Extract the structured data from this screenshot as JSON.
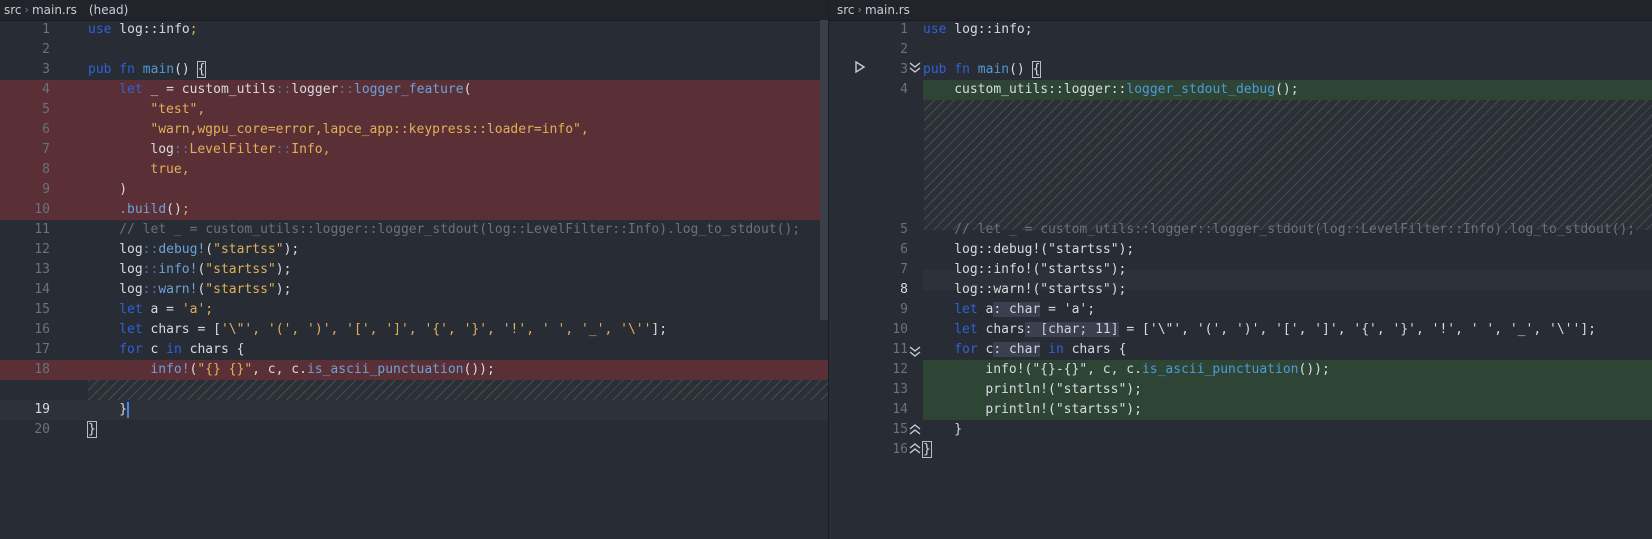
{
  "left": {
    "breadcrumb": [
      "src",
      "main.rs"
    ],
    "tag": "(head)",
    "line_numbers": [
      "1",
      "2",
      "3",
      "4",
      "5",
      "6",
      "7",
      "8",
      "9",
      "10",
      "11",
      "12",
      "13",
      "14",
      "15",
      "16",
      "17",
      "18",
      "19",
      "20"
    ],
    "current_line": "19"
  },
  "right": {
    "breadcrumb": [
      "src",
      "main.rs"
    ],
    "line_numbers": [
      "1",
      "2",
      "3",
      "4",
      "5",
      "6",
      "7",
      "8",
      "9",
      "10",
      "11",
      "12",
      "13",
      "14",
      "15",
      "16"
    ],
    "current_line": "8"
  },
  "icons": {
    "run": "play-icon",
    "fold": "chevron-down-double-icon",
    "unfold": "chevron-up-double-icon",
    "separator": "chevron-right-icon"
  },
  "colors": {
    "background": "#282c34",
    "deleted_line": "#5a2f35",
    "added_line": "#2e4536",
    "keyword": "#2e62d6",
    "function": "#4f9ad6"
  }
}
